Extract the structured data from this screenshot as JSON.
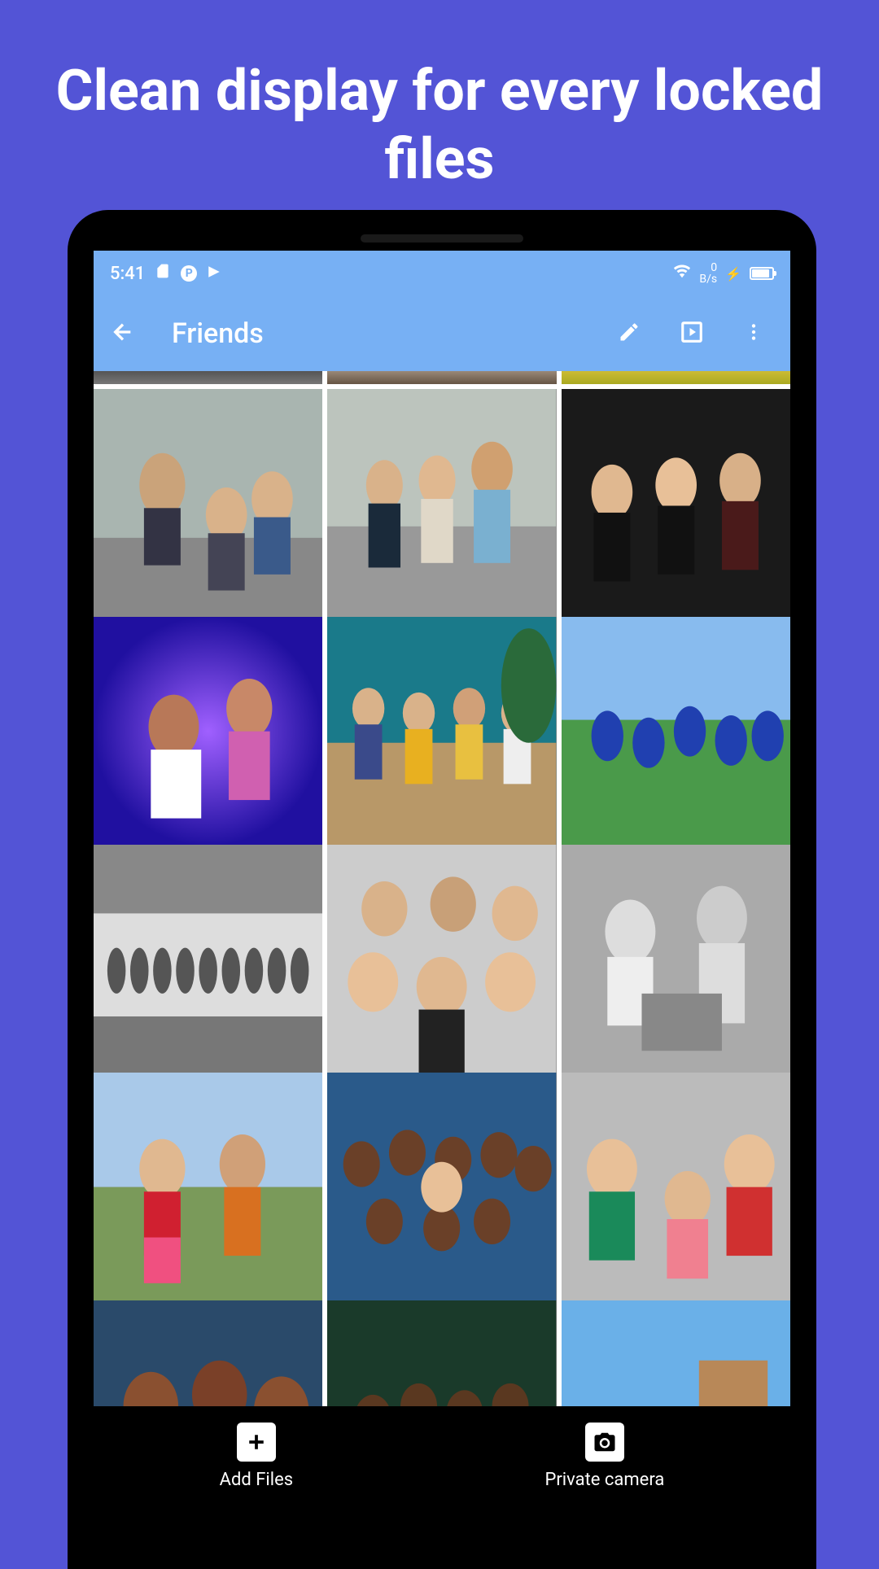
{
  "promo": {
    "title": "Clean display for every locked files"
  },
  "status_bar": {
    "time": "5:41",
    "speed_top": "0",
    "speed_bottom": "B/s"
  },
  "app_bar": {
    "title": "Friends"
  },
  "bottom_actions": {
    "add_files": "Add Files",
    "private_camera": "Private camera"
  },
  "grid": {
    "photo_alt": "Photo thumbnail"
  }
}
